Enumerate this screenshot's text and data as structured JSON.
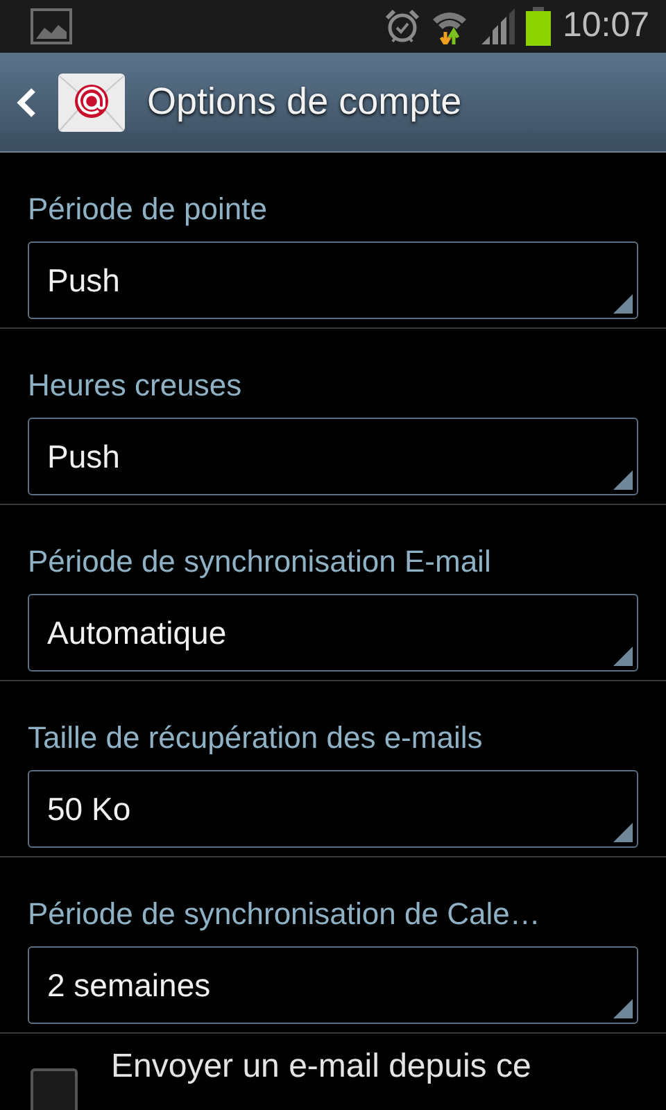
{
  "status_bar": {
    "time": "10:07"
  },
  "title_bar": {
    "title": "Options de compte"
  },
  "settings": [
    {
      "kind": "dropdown",
      "label": "Période de pointe",
      "value": "Push"
    },
    {
      "kind": "dropdown",
      "label": "Heures creuses",
      "value": "Push"
    },
    {
      "kind": "dropdown",
      "label": "Période de synchronisation E-mail",
      "value": "Automatique"
    },
    {
      "kind": "dropdown",
      "label": "Taille de récupération des e-mails",
      "value": "50 Ko"
    },
    {
      "kind": "dropdown",
      "label": "Période de synchronisation de Cale…",
      "value": "2 semaines"
    },
    {
      "kind": "checkbox",
      "label": "Envoyer un e-mail depuis ce",
      "checked": false
    }
  ]
}
